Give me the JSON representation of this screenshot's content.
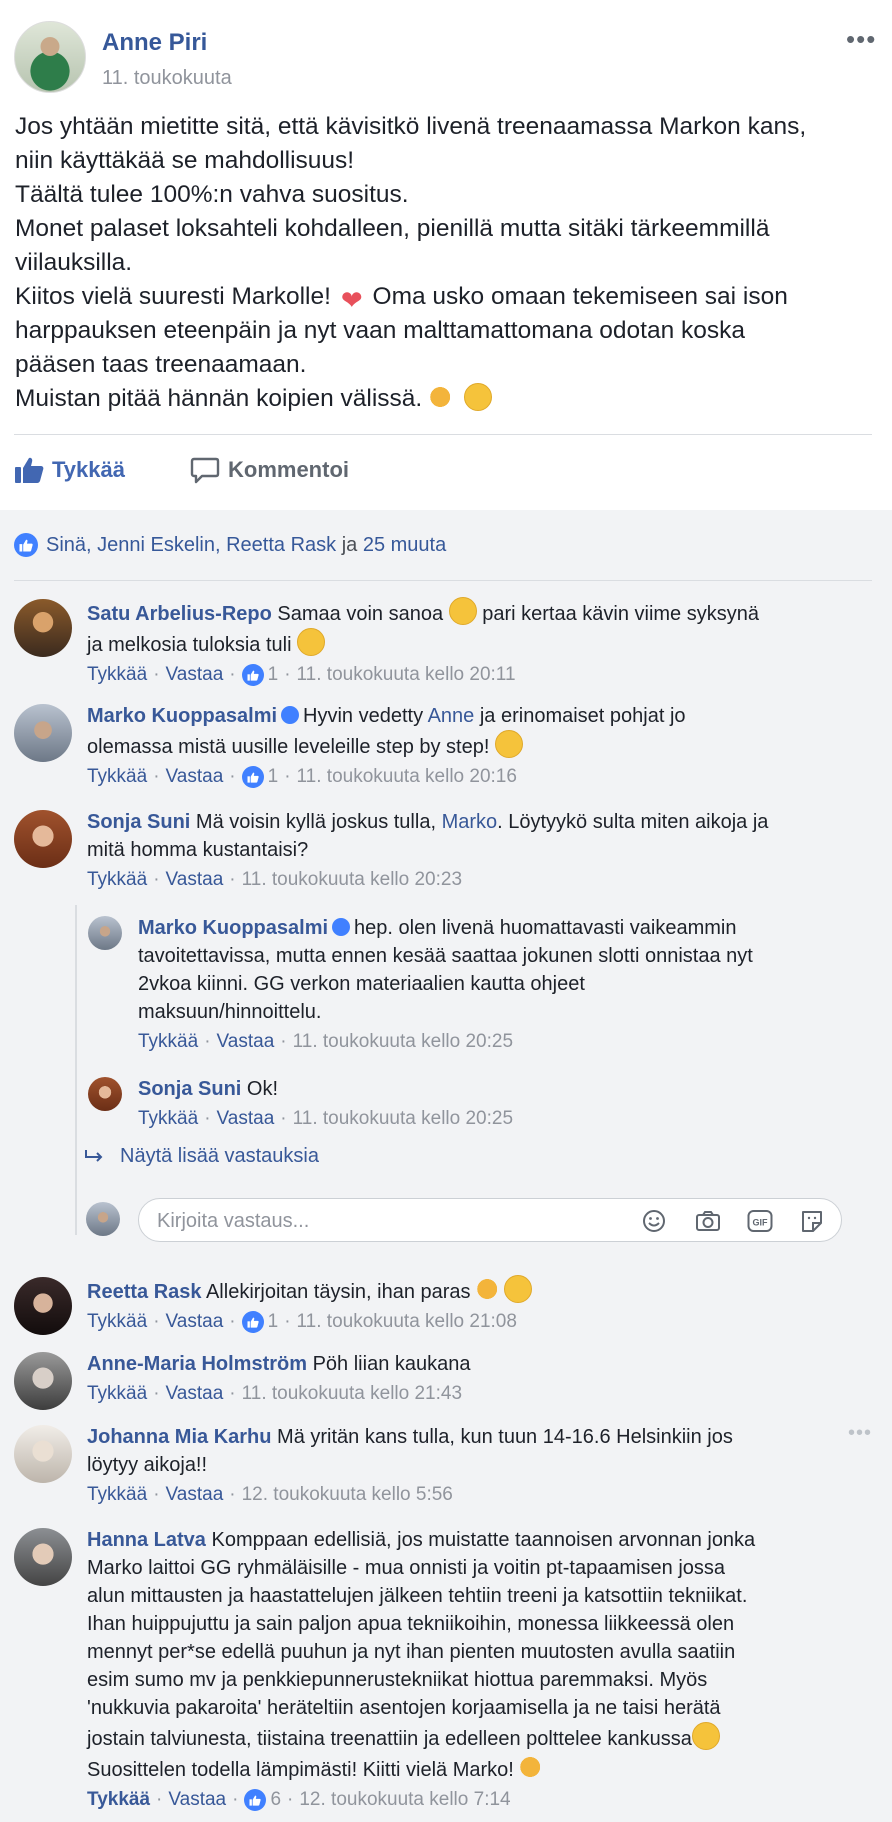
{
  "post": {
    "author": "Anne Piri",
    "date": "11. toukokuuta",
    "more": "•••",
    "lines": [
      "Jos yhtään mietitte sitä, että kävisitkö livenä treenaamassa Markon kans,",
      "niin käyttäkää se mahdollisuus!",
      "Täältä tulee 100%:n vahva suositus.",
      "Monet palaset loksahteli kohdalleen, pienillä mutta sitäki tärkeemmillä",
      "viilauksilla.",
      "Kiitos vielä suuresti Markolle!",
      "Oma usko omaan tekemiseen sai ison",
      "harppauksen eteenpäin ja nyt vaan malttamattomana odotan koska",
      "pääsen taas treenaamaan.",
      "Muistan pitää hännän koipien välissä."
    ],
    "heart_glyph": "❤"
  },
  "actions": {
    "like": "Tykkää",
    "comment": "Kommentoi"
  },
  "likes_summary": {
    "names": "Sinä, Jenni Eskelin, Reetta Rask",
    "joiner": " ja ",
    "others": "25 muuta"
  },
  "labels": {
    "like": "Tykkää",
    "reply": "Vastaa",
    "sep": "·",
    "show_more_replies": "Näytä lisää vastauksia",
    "reply_placeholder": "Kirjoita vastaus..."
  },
  "comments": [
    {
      "name": "Satu Arbelius-Repo",
      "text1": "Samaa voin sanoa",
      "text2": "pari kertaa kävin viime syksynä",
      "text3": "ja melkosia tuloksia tuli",
      "likes": "1",
      "time": "11. toukokuuta kello 20:11"
    },
    {
      "name": "Marko Kuoppasalmi",
      "text1": "Hyvin vedetty",
      "tag": "Anne",
      "text2": "ja erinomaiset pohjat jo",
      "text3": "olemassa mistä uusille leveleille step by step!",
      "likes": "1",
      "time": "11. toukokuuta kello 20:16"
    },
    {
      "name": "Sonja Suni",
      "text1": "Mä voisin kyllä joskus tulla,",
      "tag": "Marko",
      "text2": ". Löytyykö sulta miten aikoja ja",
      "text3": "mitä homma kustantaisi?",
      "time": "11. toukokuuta kello 20:23"
    },
    {
      "name": "Marko Kuoppasalmi",
      "text1": "hep. olen livenä huomattavasti vaikeammin",
      "text2": "tavoitettavissa, mutta ennen kesää saattaa jokunen slotti onnistaa nyt",
      "text3": "2vkoa kiinni. GG verkon materiaalien kautta ohjeet",
      "text4": "maksuun/hinnoittelu.",
      "time": "11. toukokuuta kello 20:25"
    },
    {
      "name": "Sonja Suni",
      "text1": "Ok!",
      "time": "11. toukokuuta kello 20:25"
    },
    {
      "name": "Reetta Rask",
      "text1": "Allekirjoitan täysin, ihan paras",
      "likes": "1",
      "time": "11. toukokuuta kello 21:08"
    },
    {
      "name": "Anne-Maria Holmström",
      "text1": "Pöh liian kaukana",
      "time": "11. toukokuuta kello 21:43"
    },
    {
      "name": "Johanna Mia Karhu",
      "text1": "Mä yritän kans tulla, kun tuun 14-16.6 Helsinkiin jos",
      "text2": "löytyy aikoja!!",
      "time": "12. toukokuuta kello 5:56"
    },
    {
      "name": "Hanna Latva",
      "text1": "Komppaan edellisiä, jos muistatte taannoisen arvonnan jonka",
      "lines": [
        "Marko laittoi GG ryhmäläisille - mua onnisti ja voitin pt-tapaamisen jossa",
        "alun mittausten ja haastattelujen jälkeen tehtiin treeni ja katsottiin tekniikat.",
        "Ihan huippujuttu ja sain paljon apua tekniikoihin, monessa liikkeessä olen",
        "mennyt per*se edellä puuhun ja nyt ihan pienten muutosten avulla saatiin",
        "esim sumo mv ja penkkiepunnerustekniikat hiottua paremmaksi. Myös",
        "'nukkuvia pakaroita' heräteltiin asentojen korjaamisella ja ne taisi herätä",
        "jostain talviunesta, tiistaina treenattiin ja edelleen polttelee kankussa",
        "Suosittelen todella lämpimästi! Kiitti vielä Marko!"
      ],
      "likes": "6",
      "time": "12. toukokuuta kello 7:14"
    }
  ],
  "colors": {
    "link_blue": "#385898",
    "like_blue": "#4267b2",
    "meta_gray": "#90949c",
    "background": "#f2f3f5"
  }
}
